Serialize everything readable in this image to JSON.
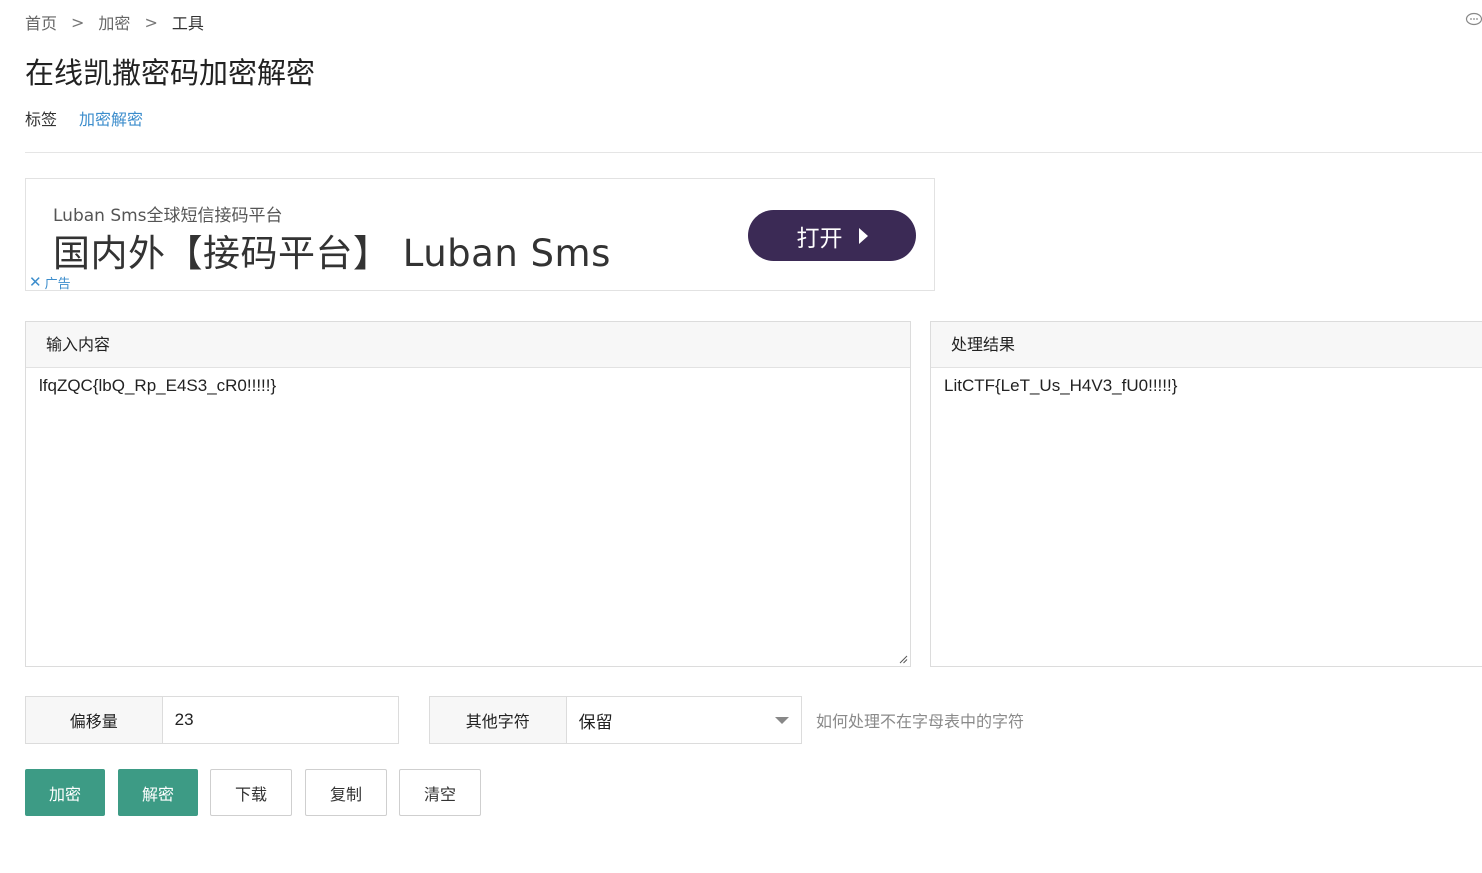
{
  "breadcrumb": {
    "items": [
      "首页",
      "加密",
      "工具"
    ],
    "separator": ">"
  },
  "page": {
    "title": "在线凯撒密码加密解密"
  },
  "tags": {
    "label": "标签",
    "links": [
      "加密解密"
    ]
  },
  "ad": {
    "subtitle": "Luban Sms全球短信接码平台",
    "headline": "国内外【接码平台】 Luban Sms",
    "button_label": "打开",
    "close_symbol": "✕",
    "ad_label": "广告"
  },
  "input_panel": {
    "header": "输入内容",
    "value": "lfqZQC{lbQ_Rp_E4S3_cR0!!!!!}"
  },
  "result_panel": {
    "header": "处理结果",
    "value": "LitCTF{LeT_Us_H4V3_fU0!!!!!}"
  },
  "offset": {
    "label": "偏移量",
    "value": "23"
  },
  "other_chars": {
    "label": "其他字符",
    "selected": "保留"
  },
  "hint": "如何处理不在字母表中的字符",
  "buttons": {
    "encrypt": "加密",
    "decrypt": "解密",
    "download": "下载",
    "copy": "复制",
    "clear": "清空"
  },
  "colors": {
    "primary": "#3d9b85",
    "link": "#3c8dcc",
    "ad_button": "#3b2a55"
  }
}
